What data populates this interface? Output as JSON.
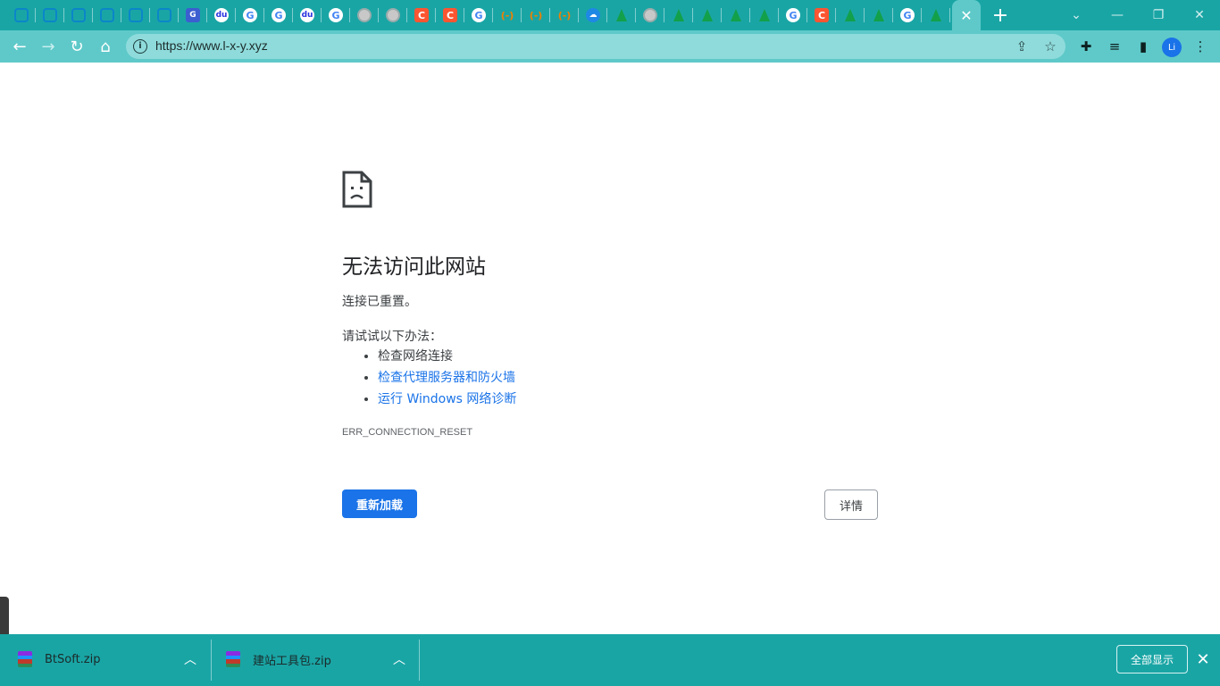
{
  "tabs": [
    {
      "icon": "bilibili-icon",
      "glyph": ""
    },
    {
      "icon": "bilibili-icon",
      "glyph": ""
    },
    {
      "icon": "bilibili-icon",
      "glyph": ""
    },
    {
      "icon": "bilibili-icon",
      "glyph": ""
    },
    {
      "icon": "bilibili-icon",
      "glyph": ""
    },
    {
      "icon": "bilibili-icon",
      "glyph": ""
    },
    {
      "icon": "translate-icon",
      "glyph": "G"
    },
    {
      "icon": "baidu-icon",
      "glyph": "du"
    },
    {
      "icon": "google-icon",
      "glyph": "G"
    },
    {
      "icon": "google-icon",
      "glyph": "G"
    },
    {
      "icon": "baidu-icon",
      "glyph": "du"
    },
    {
      "icon": "google-icon",
      "glyph": "G"
    },
    {
      "icon": "globe-icon",
      "glyph": ""
    },
    {
      "icon": "globe-icon",
      "glyph": ""
    },
    {
      "icon": "csdn-icon",
      "glyph": "C"
    },
    {
      "icon": "csdn-icon",
      "glyph": "C"
    },
    {
      "icon": "google-icon",
      "glyph": "G"
    },
    {
      "icon": "link-icon",
      "glyph": "(-)"
    },
    {
      "icon": "link-icon",
      "glyph": "(-)"
    },
    {
      "icon": "link-icon",
      "glyph": "(-)"
    },
    {
      "icon": "cloud-icon",
      "glyph": "☁"
    },
    {
      "icon": "leaf-icon",
      "glyph": ""
    },
    {
      "icon": "globe-icon",
      "glyph": ""
    },
    {
      "icon": "leaf-icon",
      "glyph": ""
    },
    {
      "icon": "leaf-icon",
      "glyph": ""
    },
    {
      "icon": "leaf-icon",
      "glyph": ""
    },
    {
      "icon": "leaf-icon",
      "glyph": ""
    },
    {
      "icon": "google-icon",
      "glyph": "G"
    },
    {
      "icon": "csdn-icon",
      "glyph": "C"
    },
    {
      "icon": "leaf-icon",
      "glyph": ""
    },
    {
      "icon": "leaf-icon",
      "glyph": ""
    },
    {
      "icon": "google-icon",
      "glyph": "G"
    },
    {
      "icon": "leaf-icon",
      "glyph": ""
    }
  ],
  "active_tab": {
    "close_glyph": "✕"
  },
  "toolbar": {
    "url": "https://www.l-x-y.xyz",
    "avatar_initials": "Li"
  },
  "error_page": {
    "title": "无法访问此网站",
    "description": "连接已重置。",
    "try_heading": "请试试以下办法：",
    "suggestions": [
      {
        "text": "检查网络连接",
        "link": false
      },
      {
        "text": "检查代理服务器和防火墙",
        "link": true
      },
      {
        "text": "运行 Windows 网络诊断",
        "link": true
      }
    ],
    "error_code": "ERR_CONNECTION_RESET",
    "reload_label": "重新加载",
    "details_label": "详情"
  },
  "downloads": {
    "items": [
      {
        "name": "BtSoft.zip"
      },
      {
        "name": "建站工具包.zip"
      }
    ],
    "show_all_label": "全部显示"
  },
  "colors": {
    "frame": "#1aa5a5",
    "toolbar": "#5fc9c9",
    "button_blue": "#1a73e8"
  }
}
